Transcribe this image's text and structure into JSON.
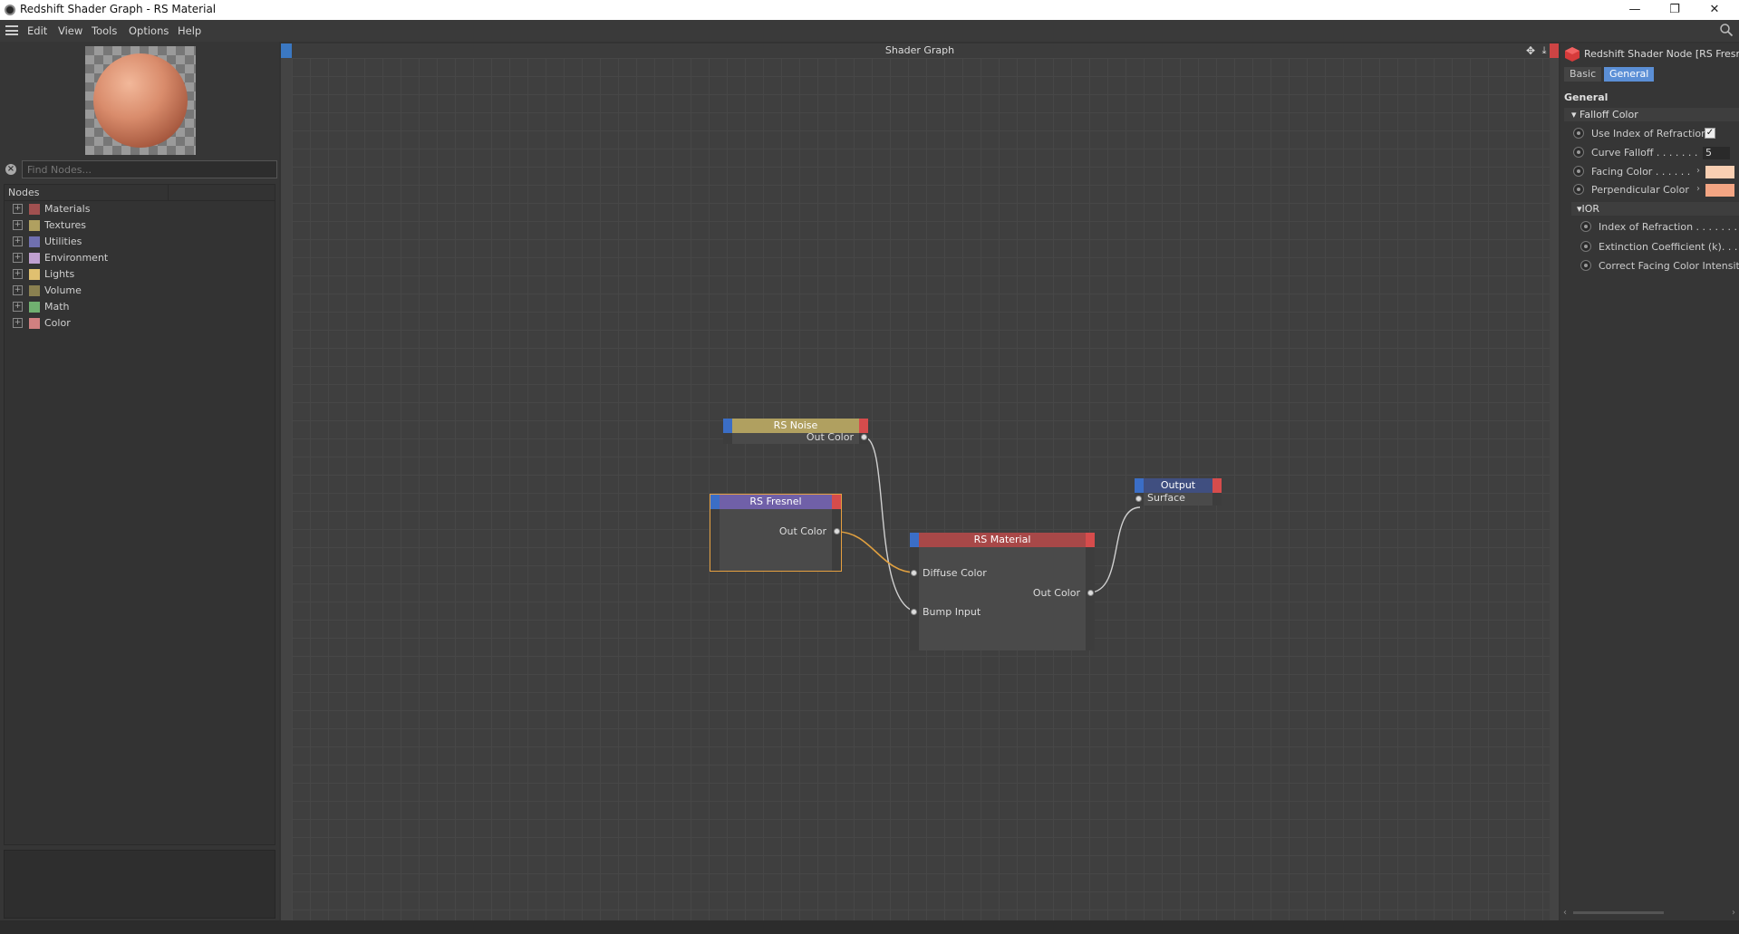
{
  "window": {
    "title": "Redshift Shader Graph - RS Material",
    "minimize": "—",
    "restore": "❐",
    "close": "✕"
  },
  "menu": [
    "Edit",
    "View",
    "Tools",
    "Options",
    "Help"
  ],
  "left": {
    "find_placeholder": "Find Nodes...",
    "tree_header": "Nodes",
    "categories": [
      {
        "label": "Materials",
        "color": "#a05050"
      },
      {
        "label": "Textures",
        "color": "#b0a060"
      },
      {
        "label": "Utilities",
        "color": "#7070b0"
      },
      {
        "label": "Environment",
        "color": "#c0a0d0"
      },
      {
        "label": "Lights",
        "color": "#e0c070"
      },
      {
        "label": "Volume",
        "color": "#8a8050"
      },
      {
        "label": "Math",
        "color": "#70b070"
      },
      {
        "label": "Color",
        "color": "#d08080"
      }
    ]
  },
  "graph": {
    "title": "Shader Graph",
    "nodes": {
      "noise": {
        "title": "RS Noise",
        "head_color": "#b0a060",
        "out": "Out Color"
      },
      "fresnel": {
        "title": "RS Fresnel",
        "head_color": "#7060a8",
        "out": "Out Color"
      },
      "material": {
        "title": "RS Material",
        "head_color": "#a84848",
        "in1": "Diffuse Color",
        "in2": "Bump Input",
        "out": "Out Color"
      },
      "output": {
        "title": "Output",
        "head_color": "#404f80",
        "in1": "Surface"
      }
    }
  },
  "attr": {
    "title": "Redshift Shader Node [RS Fresnel]",
    "tabs": [
      "Basic",
      "General"
    ],
    "active_tab": "General",
    "section": "General",
    "falloff_group": "Falloff Color",
    "use_ior_label": "Use Index of Refraction",
    "use_ior_checked": "✓",
    "curve_falloff_label": "Curve Falloff . . . . . . .",
    "curve_falloff_value": "5",
    "facing_color_label": "Facing Color . . . . . .",
    "facing_color": "#f9cfb2",
    "perp_color_label": "Perpendicular Color",
    "perp_color": "#f3a583",
    "ior_group": "IOR",
    "ior_label": "Index of Refraction . . . . . . .",
    "extinction_label": "Extinction Coefficient (k). . . .",
    "correct_label": "Correct Facing Color Intensity"
  }
}
